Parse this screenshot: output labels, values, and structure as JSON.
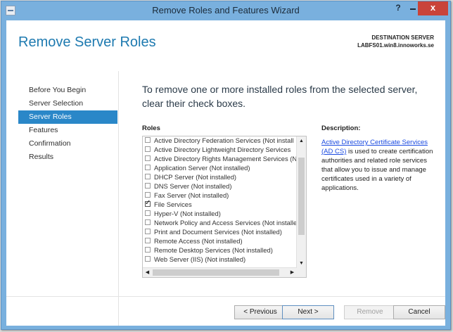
{
  "window": {
    "title": "Remove Roles and Features Wizard",
    "controls": {
      "help": "?",
      "minimize": "",
      "close": "x"
    }
  },
  "header": {
    "title": "Remove Server Roles",
    "destination_label": "DESTINATION SERVER",
    "destination_value": "LABFS01.win8.innoworks.se"
  },
  "nav": {
    "items": [
      {
        "label": "Before You Begin",
        "active": false
      },
      {
        "label": "Server Selection",
        "active": false
      },
      {
        "label": "Server Roles",
        "active": true
      },
      {
        "label": "Features",
        "active": false
      },
      {
        "label": "Confirmation",
        "active": false
      },
      {
        "label": "Results",
        "active": false
      }
    ]
  },
  "main": {
    "instruction": "To remove one or more installed roles from the selected server, clear their check boxes.",
    "roles_label": "Roles",
    "roles": [
      {
        "label": "Active Directory Federation Services (Not install",
        "checked": false
      },
      {
        "label": "Active Directory Lightweight Directory Services",
        "checked": false
      },
      {
        "label": "Active Directory Rights Management Services (N",
        "checked": false
      },
      {
        "label": "Application Server (Not installed)",
        "checked": false
      },
      {
        "label": "DHCP Server (Not installed)",
        "checked": false
      },
      {
        "label": "DNS Server (Not installed)",
        "checked": false
      },
      {
        "label": "Fax Server (Not installed)",
        "checked": false
      },
      {
        "label": "File Services",
        "checked": true
      },
      {
        "label": "Hyper-V (Not installed)",
        "checked": false
      },
      {
        "label": "Network Policy and Access Services (Not installe",
        "checked": false
      },
      {
        "label": "Print and Document Services (Not installed)",
        "checked": false
      },
      {
        "label": "Remote Access (Not installed)",
        "checked": false
      },
      {
        "label": "Remote Desktop Services (Not installed)",
        "checked": false
      },
      {
        "label": "Web Server (IIS) (Not installed)",
        "checked": false
      }
    ],
    "scroll_icons": {
      "up": "▲",
      "down": "▼",
      "left": "◀",
      "right": "▶"
    },
    "description_label": "Description:",
    "description_link": "Active Directory Certificate Services (AD CS)",
    "description_text": " is used to create certification authorities and related role services that allow you to issue and manage certificates used in a variety of applications."
  },
  "footer": {
    "previous": "< Previous",
    "next": "Next >",
    "remove": "Remove",
    "cancel": "Cancel"
  },
  "colors": {
    "accent": "#2a87c8",
    "title_blue": "#1e7ab0",
    "close_red": "#c9443a",
    "frame": "#79b0de"
  }
}
